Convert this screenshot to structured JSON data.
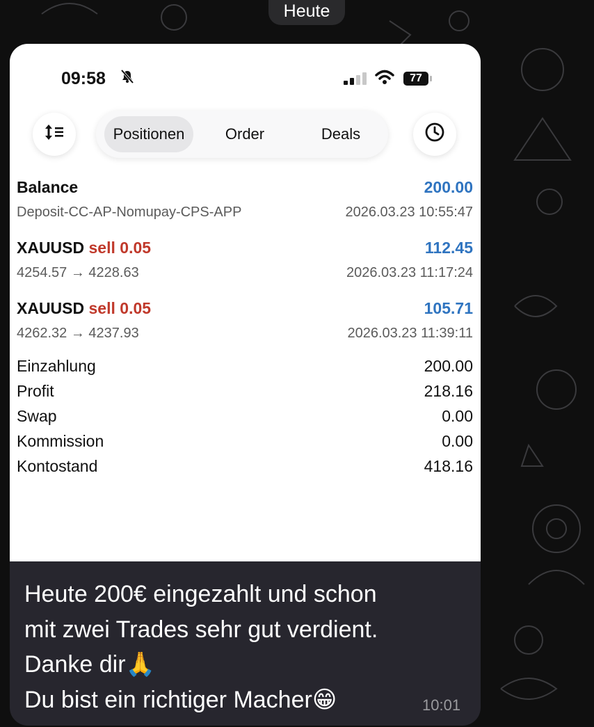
{
  "chat": {
    "day_label": "Heute",
    "message_lines": [
      "Heute 200€ eingezahlt und schon",
      "mit zwei Trades sehr gut verdient.",
      "Danke dir🙏",
      "Du bist ein richtiger Macher😁"
    ],
    "message_time": "10:01"
  },
  "phone": {
    "status": {
      "time": "09:58",
      "battery": "77",
      "signal_bars_active": 2,
      "signal_bars_total": 4,
      "icons": [
        "bell-slash-icon",
        "signal-icon",
        "wifi-icon",
        "battery-icon"
      ]
    },
    "toolbar": {
      "sort_icon": "sort-icon",
      "tabs": [
        {
          "label": "Positionen",
          "active": true
        },
        {
          "label": "Order",
          "active": false
        },
        {
          "label": "Deals",
          "active": false
        }
      ],
      "history_icon": "clock-icon"
    },
    "deals": [
      {
        "title": "Balance",
        "side": "",
        "lot": "",
        "amount": "200.00",
        "subtitle": "Deposit-CC-AP-Nomupay-CPS-APP",
        "datetime": "2026.03.23 10:55:47"
      },
      {
        "title": "XAUUSD",
        "side": "sell",
        "lot": "0.05",
        "amount": "112.45",
        "subtitle": "4254.57 → 4228.63",
        "datetime": "2026.03.23 11:17:24"
      },
      {
        "title": "XAUUSD",
        "side": "sell",
        "lot": "0.05",
        "amount": "105.71",
        "subtitle": "4262.32 → 4237.93",
        "datetime": "2026.03.23 11:39:11"
      }
    ],
    "summary": [
      {
        "label": "Einzahlung",
        "value": "200.00"
      },
      {
        "label": "Profit",
        "value": "218.16"
      },
      {
        "label": "Swap",
        "value": "0.00"
      },
      {
        "label": "Kommission",
        "value": "0.00"
      },
      {
        "label": "Kontostand",
        "value": "418.16"
      }
    ]
  },
  "colors": {
    "amount_blue": "#2f74c0",
    "sell_red": "#c0392b",
    "bubble_bg": "#27262e",
    "chat_bg": "#0f0f0f"
  }
}
